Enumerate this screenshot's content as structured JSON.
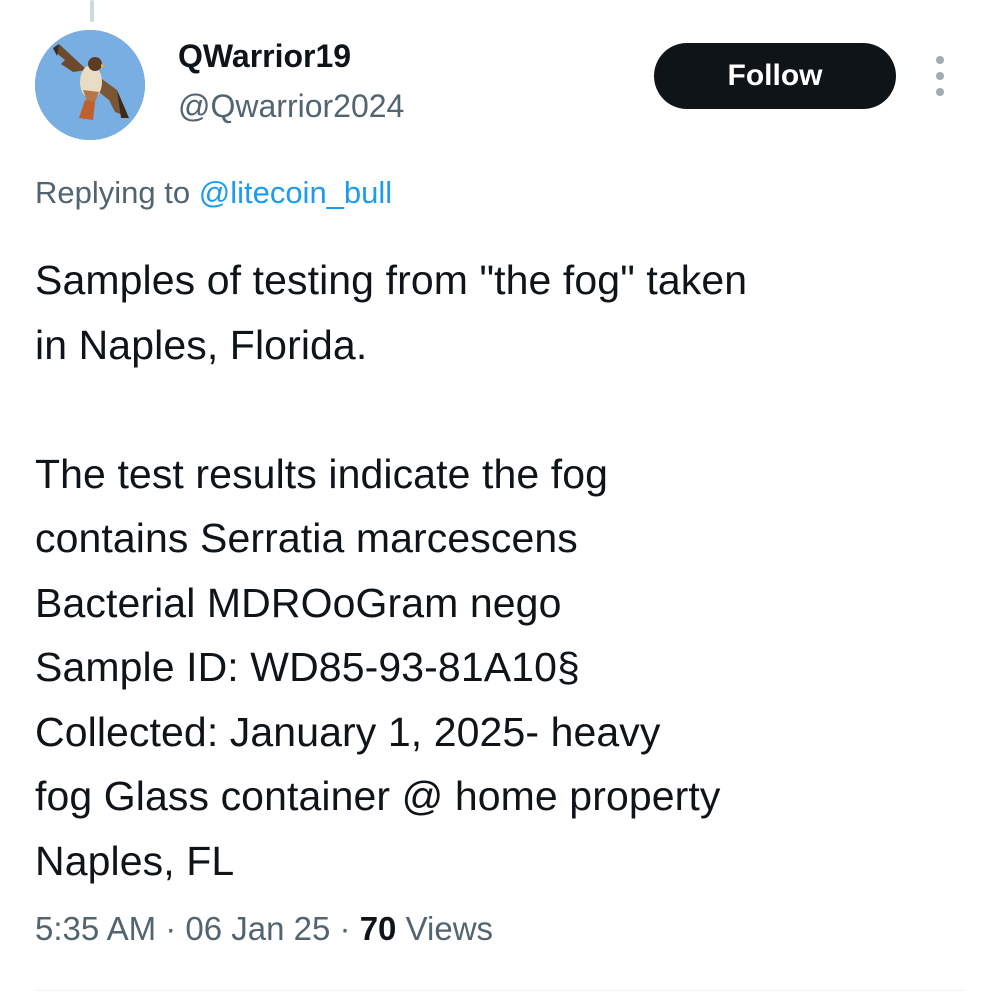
{
  "author": {
    "display_name": "QWarrior19",
    "handle": "@Qwarrior2024",
    "avatar_icon": "hawk-avatar"
  },
  "actions": {
    "follow_label": "Follow",
    "more_icon": "more-vertical-icon"
  },
  "reply": {
    "prefix": "Replying to ",
    "mention": "@litecoin_bull"
  },
  "tweet": {
    "text": "Samples of testing from \"the fog\" taken\nin Naples, Florida.\n\nThe test results indicate the fog\ncontains Serratia marcescens\nBacterial MDROoGram nego\nSample ID: WD85-93-81A10§\nCollected: January 1, 2025- heavy\nfog Glass container @ home property\nNaples, FL"
  },
  "meta": {
    "time": "5:35 AM",
    "separator": " · ",
    "date": "06 Jan 25",
    "views_count": "70",
    "views_label": " Views"
  },
  "colors": {
    "text_primary": "#0f1419",
    "text_secondary": "#536471",
    "link": "#1d9bf0",
    "follow_bg": "#0f1419"
  }
}
